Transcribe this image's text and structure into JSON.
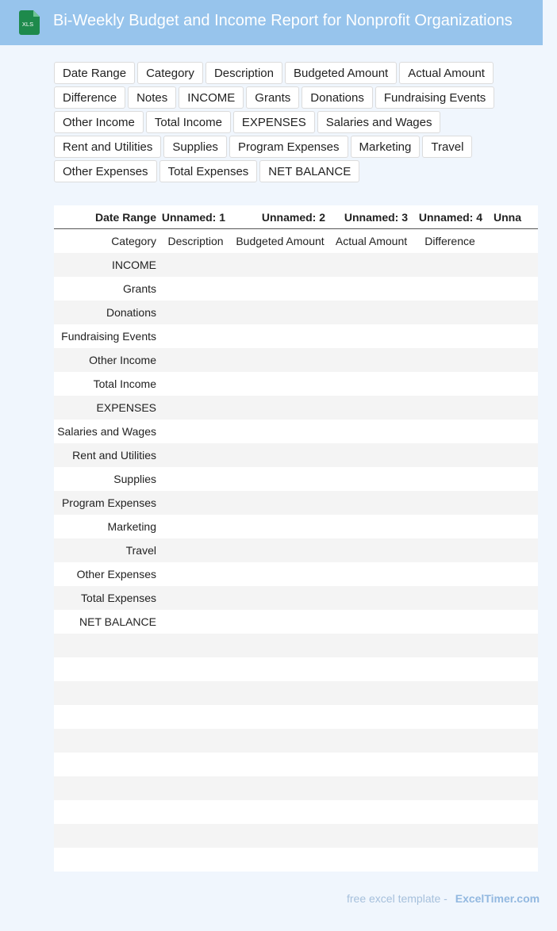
{
  "header": {
    "title": "Bi-Weekly Budget and Income Report for Nonprofit Organizations",
    "icon": "xls-file-icon",
    "icon_label": "XLS",
    "accent": "#97c4ec"
  },
  "tags": [
    "Date Range",
    "Category",
    "Description",
    "Budgeted Amount",
    "Actual Amount",
    "Difference",
    "Notes",
    "INCOME",
    "Grants",
    "Donations",
    "Fundraising Events",
    "Other Income",
    "Total Income",
    "EXPENSES",
    "Salaries and Wages",
    "Rent and Utilities",
    "Supplies",
    "Program Expenses",
    "Marketing",
    "Travel",
    "Other Expenses",
    "Total Expenses",
    "NET BALANCE"
  ],
  "table": {
    "headers": [
      "Date Range",
      "Unnamed: 1",
      "Unnamed: 2",
      "Unnamed: 3",
      "Unnamed: 4",
      "Unna"
    ],
    "rows": [
      {
        "idx": "0",
        "cells": [
          "Category",
          "Description",
          "Budgeted Amount",
          "Actual Amount",
          "Difference",
          ""
        ]
      },
      {
        "idx": "1",
        "cells": [
          "INCOME",
          "",
          "",
          "",
          "",
          ""
        ]
      },
      {
        "idx": "2",
        "cells": [
          "Grants",
          "",
          "",
          "",
          "",
          ""
        ]
      },
      {
        "idx": "3",
        "cells": [
          "Donations",
          "",
          "",
          "",
          "",
          ""
        ]
      },
      {
        "idx": "4",
        "cells": [
          "Fundraising Events",
          "",
          "",
          "",
          "",
          ""
        ]
      },
      {
        "idx": "5",
        "cells": [
          "Other Income",
          "",
          "",
          "",
          "",
          ""
        ]
      },
      {
        "idx": "6",
        "cells": [
          "Total Income",
          "",
          "",
          "",
          "",
          ""
        ]
      },
      {
        "idx": "7",
        "cells": [
          "EXPENSES",
          "",
          "",
          "",
          "",
          ""
        ]
      },
      {
        "idx": "8",
        "cells": [
          "Salaries and Wages",
          "",
          "",
          "",
          "",
          ""
        ]
      },
      {
        "idx": "9",
        "cells": [
          "Rent and Utilities",
          "",
          "",
          "",
          "",
          ""
        ]
      },
      {
        "idx": "0",
        "cells": [
          "Supplies",
          "",
          "",
          "",
          "",
          ""
        ]
      },
      {
        "idx": "1",
        "cells": [
          "Program Expenses",
          "",
          "",
          "",
          "",
          ""
        ]
      },
      {
        "idx": "2",
        "cells": [
          "Marketing",
          "",
          "",
          "",
          "",
          ""
        ]
      },
      {
        "idx": "3",
        "cells": [
          "Travel",
          "",
          "",
          "",
          "",
          ""
        ]
      },
      {
        "idx": "4",
        "cells": [
          "Other Expenses",
          "",
          "",
          "",
          "",
          ""
        ]
      },
      {
        "idx": "5",
        "cells": [
          "Total Expenses",
          "",
          "",
          "",
          "",
          ""
        ]
      },
      {
        "idx": "6",
        "cells": [
          "NET BALANCE",
          "",
          "",
          "",
          "",
          ""
        ]
      },
      {
        "idx": "7",
        "cells": [
          "",
          "",
          "",
          "",
          "",
          ""
        ]
      },
      {
        "idx": "8",
        "cells": [
          "",
          "",
          "",
          "",
          "",
          ""
        ]
      },
      {
        "idx": "9",
        "cells": [
          "",
          "",
          "",
          "",
          "",
          ""
        ]
      },
      {
        "idx": "0",
        "cells": [
          "",
          "",
          "",
          "",
          "",
          ""
        ]
      },
      {
        "idx": "1",
        "cells": [
          "",
          "",
          "",
          "",
          "",
          ""
        ]
      },
      {
        "idx": "2",
        "cells": [
          "",
          "",
          "",
          "",
          "",
          ""
        ]
      },
      {
        "idx": "3",
        "cells": [
          "",
          "",
          "",
          "",
          "",
          ""
        ]
      },
      {
        "idx": "4",
        "cells": [
          "",
          "",
          "",
          "",
          "",
          ""
        ]
      },
      {
        "idx": "5",
        "cells": [
          "",
          "",
          "",
          "",
          "",
          ""
        ]
      },
      {
        "idx": "6",
        "cells": [
          "",
          "",
          "",
          "",
          "",
          ""
        ]
      }
    ]
  },
  "footer": {
    "prefix": "free excel template -",
    "brand": "ExcelTimer.com"
  }
}
